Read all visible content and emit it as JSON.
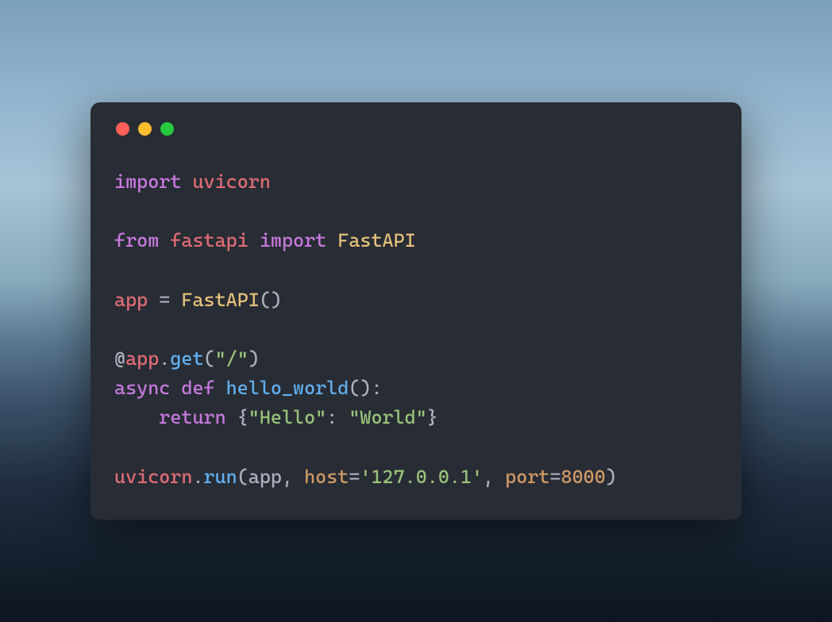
{
  "window": {
    "traffic_lights": [
      "red",
      "yellow",
      "green"
    ]
  },
  "code": {
    "lines": [
      [
        {
          "cls": "tok-keyword",
          "t": "import"
        },
        {
          "cls": "tok-plain",
          "t": " "
        },
        {
          "cls": "tok-module",
          "t": "uvicorn"
        }
      ],
      [],
      [
        {
          "cls": "tok-keyword",
          "t": "from"
        },
        {
          "cls": "tok-plain",
          "t": " "
        },
        {
          "cls": "tok-module",
          "t": "fastapi"
        },
        {
          "cls": "tok-plain",
          "t": " "
        },
        {
          "cls": "tok-keyword",
          "t": "import"
        },
        {
          "cls": "tok-plain",
          "t": " "
        },
        {
          "cls": "tok-class",
          "t": "FastAPI"
        }
      ],
      [],
      [
        {
          "cls": "tok-var",
          "t": "app"
        },
        {
          "cls": "tok-plain",
          "t": " "
        },
        {
          "cls": "tok-op",
          "t": "="
        },
        {
          "cls": "tok-plain",
          "t": " "
        },
        {
          "cls": "tok-class",
          "t": "FastAPI"
        },
        {
          "cls": "tok-paren",
          "t": "()"
        }
      ],
      [],
      [
        {
          "cls": "tok-decorator-at",
          "t": "@"
        },
        {
          "cls": "tok-decorator-name",
          "t": "app"
        },
        {
          "cls": "tok-plain",
          "t": "."
        },
        {
          "cls": "tok-func-call",
          "t": "get"
        },
        {
          "cls": "tok-paren",
          "t": "("
        },
        {
          "cls": "tok-string",
          "t": "\"/\""
        },
        {
          "cls": "tok-paren",
          "t": ")"
        }
      ],
      [
        {
          "cls": "tok-keyword",
          "t": "async"
        },
        {
          "cls": "tok-plain",
          "t": " "
        },
        {
          "cls": "tok-keyword",
          "t": "def"
        },
        {
          "cls": "tok-plain",
          "t": " "
        },
        {
          "cls": "tok-func-def",
          "t": "hello_world"
        },
        {
          "cls": "tok-paren",
          "t": "():"
        }
      ],
      [
        {
          "cls": "tok-plain",
          "t": "    "
        },
        {
          "cls": "tok-keyword",
          "t": "return"
        },
        {
          "cls": "tok-plain",
          "t": " "
        },
        {
          "cls": "tok-paren",
          "t": "{"
        },
        {
          "cls": "tok-string",
          "t": "\"Hello\""
        },
        {
          "cls": "tok-plain",
          "t": ": "
        },
        {
          "cls": "tok-string",
          "t": "\"World\""
        },
        {
          "cls": "tok-paren",
          "t": "}"
        }
      ],
      [],
      [
        {
          "cls": "tok-module",
          "t": "uvicorn"
        },
        {
          "cls": "tok-plain",
          "t": "."
        },
        {
          "cls": "tok-func-call",
          "t": "run"
        },
        {
          "cls": "tok-paren",
          "t": "("
        },
        {
          "cls": "tok-plain",
          "t": "app, "
        },
        {
          "cls": "tok-param",
          "t": "host"
        },
        {
          "cls": "tok-op",
          "t": "="
        },
        {
          "cls": "tok-string",
          "t": "'127.0.0.1'"
        },
        {
          "cls": "tok-plain",
          "t": ", "
        },
        {
          "cls": "tok-param",
          "t": "port"
        },
        {
          "cls": "tok-op",
          "t": "="
        },
        {
          "cls": "tok-number",
          "t": "8000"
        },
        {
          "cls": "tok-paren",
          "t": ")"
        }
      ]
    ]
  }
}
